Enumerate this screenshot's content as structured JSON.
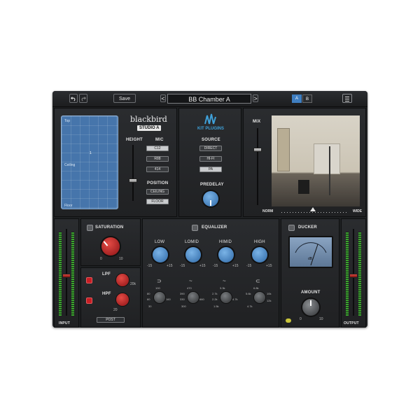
{
  "topbar": {
    "undo_icon": "undo-icon",
    "redo_icon": "redo-icon",
    "save_label": "Save",
    "prev_arrow": "<",
    "preset_name": "BB Chamber A",
    "next_arrow": ">",
    "a_label": "A",
    "b_label": "B",
    "menu_icon": "hamburger-menu-icon"
  },
  "room": {
    "top_label": "Top",
    "ceiling_label": "Ceiling",
    "floor_label": "Floor",
    "marker": "1"
  },
  "brand": {
    "logo_text": "blackbird",
    "studio_badge": "STUDIO A",
    "sublogo": "KIT PLUGINS"
  },
  "height": {
    "label": "HEIGHT"
  },
  "mic": {
    "label": "MIC",
    "options": [
      "C12",
      "R88",
      "414"
    ],
    "selected": "C12"
  },
  "position": {
    "label": "POSITION",
    "options": [
      "CEILING",
      "FLOOR"
    ],
    "selected": "FLOOR"
  },
  "source": {
    "label": "SOURCE",
    "options": [
      "DIRECT",
      "HI-FI",
      "PA"
    ],
    "selected": "PA"
  },
  "predelay": {
    "label": "PREDELAY"
  },
  "mix": {
    "label": "MIX",
    "norm_label": "NORM",
    "wide_label": "WIDE"
  },
  "saturation": {
    "title": "SATURATION",
    "min": "0",
    "max": "10"
  },
  "filters": {
    "lpf_label": "LPF",
    "hpf_label": "HPF",
    "lpf_max": "20k",
    "hpf_min": "20",
    "post_label": "POST"
  },
  "equalizer": {
    "title": "EQUALIZER",
    "bands": [
      {
        "name": "LOW",
        "min": "-15",
        "max": "+15",
        "freqs": [
          "100",
          "80",
          "60",
          "30",
          "160"
        ]
      },
      {
        "name": "LOMID",
        "min": "-15",
        "max": "+15",
        "freqs": [
          "470",
          "390",
          "330",
          "300",
          "660"
        ]
      },
      {
        "name": "HIMID",
        "min": "-15",
        "max": "+15",
        "freqs": [
          "3.3k",
          "2.7k",
          "2.2k",
          "1.5k",
          "4.7k"
        ]
      },
      {
        "name": "HIGH",
        "min": "-15",
        "max": "+15",
        "freqs": [
          "6.8k",
          "5.6k",
          "10k",
          "4.7k",
          "12k"
        ]
      }
    ]
  },
  "ducker": {
    "title": "DUCKER",
    "vu_label": "dB",
    "amount_label": "AMOUNT",
    "min": "0",
    "max": "10"
  },
  "io": {
    "input_label": "INPUT",
    "output_label": "OUTPUT"
  },
  "colors": {
    "accent_blue": "#3f7ec0",
    "knob_red": "#c81e24",
    "meter_green": "#3aa82c"
  }
}
